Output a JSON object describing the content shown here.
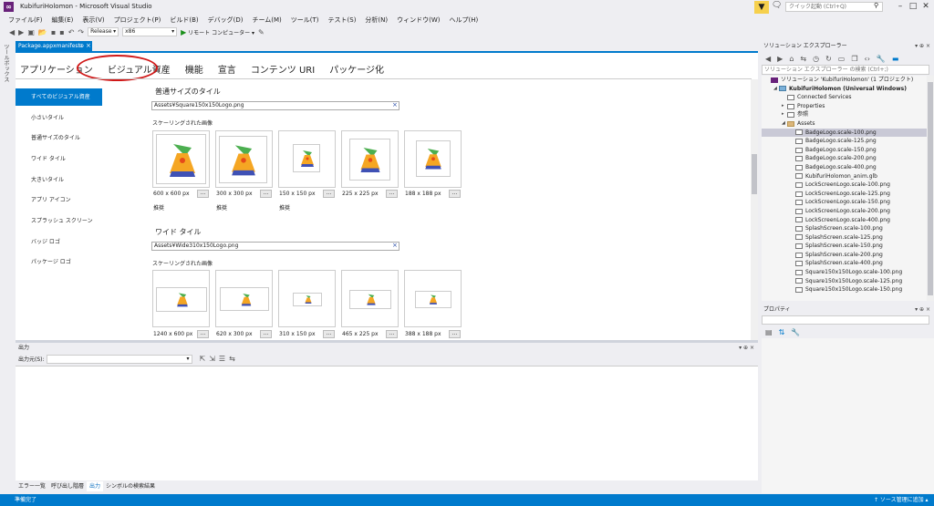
{
  "window": {
    "title": "KubifuriHolomon - Microsoft Visual Studio",
    "quick_launch_placeholder": "クイック起動 (Ctrl+Q)"
  },
  "menu": [
    "ファイル(F)",
    "編集(E)",
    "表示(V)",
    "プロジェクト(P)",
    "ビルド(B)",
    "デバッグ(D)",
    "チーム(M)",
    "ツール(T)",
    "テスト(S)",
    "分析(N)",
    "ウィンドウ(W)",
    "ヘルプ(H)"
  ],
  "toolbar": {
    "config": "Release",
    "platform": "x86",
    "run_label": "リモート コンピューター"
  },
  "left_strip": {
    "toolbox_label": "ツールボックス"
  },
  "document_tab": {
    "label": "Package.appxmanifest",
    "pin": "⊕",
    "close": "×"
  },
  "manifest_tabs": [
    "アプリケーション",
    "ビジュアル資産",
    "機能",
    "宣言",
    "コンテンツ URI",
    "パッケージ化"
  ],
  "left_nav": [
    "すべてのビジュアル資産",
    "小さいタイル",
    "普通サイズのタイル",
    "ワイド タイル",
    "大きいタイル",
    "アプリ アイコン",
    "スプラッシュ スクリーン",
    "バッジ ロゴ",
    "パッケージ ロゴ"
  ],
  "sections": {
    "medium": {
      "title": "普通サイズのタイル",
      "path": "Assets¥Square150x150Logo.png",
      "scaled_label": "スケーリングされた画像",
      "tiles": [
        {
          "size": "600 x 600 px",
          "recommended": "推奨"
        },
        {
          "size": "300 x 300 px",
          "recommended": "推奨"
        },
        {
          "size": "150 x 150 px",
          "recommended": "推奨"
        },
        {
          "size": "225 x 225 px",
          "recommended": ""
        },
        {
          "size": "188 x 188 px",
          "recommended": ""
        }
      ]
    },
    "wide": {
      "title": "ワイド タイル",
      "path": "Assets¥Wide310x150Logo.png",
      "scaled_label": "スケーリングされた画像",
      "tiles": [
        {
          "size": "1240 x 600 px"
        },
        {
          "size": "620 x 300 px"
        },
        {
          "size": "310 x 150 px"
        },
        {
          "size": "465 x 225 px"
        },
        {
          "size": "388 x 188 px"
        }
      ]
    },
    "browse_label": "...",
    "clear_label": "×"
  },
  "output": {
    "header": "出力",
    "source_label": "出力元(S):",
    "header_controls": "▾ ⊕ ×"
  },
  "bottom_tabs": [
    "エラー一覧",
    "呼び出し階層",
    "出力",
    "シンボルの検索結果"
  ],
  "status": {
    "left": "準備完了",
    "right": "↑ ソース管理に追加 ▴"
  },
  "solution_explorer": {
    "header": "ソリューション エクスプローラー",
    "header_controls": "▾ ⊕ ×",
    "search_placeholder": "ソリューション エクスプローラー の検索 (Ctrl+;)",
    "tree": [
      {
        "label": "ソリューション 'KubifuriHolomon' (1 プロジェクト)",
        "depth": 0,
        "arrow": "",
        "icon": "sol",
        "bold": false
      },
      {
        "label": "KubifuriHolomon (Universal Windows)",
        "depth": 1,
        "arrow": "◢",
        "icon": "proj",
        "bold": true
      },
      {
        "label": "Connected Services",
        "depth": 2,
        "arrow": "",
        "icon": "file"
      },
      {
        "label": "Properties",
        "depth": 2,
        "arrow": "▸",
        "icon": "file"
      },
      {
        "label": "参照",
        "depth": 2,
        "arrow": "▸",
        "icon": "file"
      },
      {
        "label": "Assets",
        "depth": 2,
        "arrow": "◢",
        "icon": "folder"
      },
      {
        "label": "BadgeLogo.scale-100.png",
        "depth": 3,
        "arrow": "",
        "icon": "file",
        "selected": true
      },
      {
        "label": "BadgeLogo.scale-125.png",
        "depth": 3,
        "arrow": "",
        "icon": "file"
      },
      {
        "label": "BadgeLogo.scale-150.png",
        "depth": 3,
        "arrow": "",
        "icon": "file"
      },
      {
        "label": "BadgeLogo.scale-200.png",
        "depth": 3,
        "arrow": "",
        "icon": "file"
      },
      {
        "label": "BadgeLogo.scale-400.png",
        "depth": 3,
        "arrow": "",
        "icon": "file"
      },
      {
        "label": "KubifuriHolomon_anim.glb",
        "depth": 3,
        "arrow": "",
        "icon": "file"
      },
      {
        "label": "LockScreenLogo.scale-100.png",
        "depth": 3,
        "arrow": "",
        "icon": "file"
      },
      {
        "label": "LockScreenLogo.scale-125.png",
        "depth": 3,
        "arrow": "",
        "icon": "file"
      },
      {
        "label": "LockScreenLogo.scale-150.png",
        "depth": 3,
        "arrow": "",
        "icon": "file"
      },
      {
        "label": "LockScreenLogo.scale-200.png",
        "depth": 3,
        "arrow": "",
        "icon": "file"
      },
      {
        "label": "LockScreenLogo.scale-400.png",
        "depth": 3,
        "arrow": "",
        "icon": "file"
      },
      {
        "label": "SplashScreen.scale-100.png",
        "depth": 3,
        "arrow": "",
        "icon": "file"
      },
      {
        "label": "SplashScreen.scale-125.png",
        "depth": 3,
        "arrow": "",
        "icon": "file"
      },
      {
        "label": "SplashScreen.scale-150.png",
        "depth": 3,
        "arrow": "",
        "icon": "file"
      },
      {
        "label": "SplashScreen.scale-200.png",
        "depth": 3,
        "arrow": "",
        "icon": "file"
      },
      {
        "label": "SplashScreen.scale-400.png",
        "depth": 3,
        "arrow": "",
        "icon": "file"
      },
      {
        "label": "Square150x150Logo.scale-100.png",
        "depth": 3,
        "arrow": "",
        "icon": "file"
      },
      {
        "label": "Square150x150Logo.scale-125.png",
        "depth": 3,
        "arrow": "",
        "icon": "file"
      },
      {
        "label": "Square150x150Logo.scale-150.png",
        "depth": 3,
        "arrow": "",
        "icon": "file"
      }
    ]
  },
  "properties": {
    "header": "プロパティ",
    "header_controls": "▾ ⊕ ×"
  },
  "colors": {
    "accent": "#007acc",
    "highlight": "#d01818",
    "selected": "#c9c9d6"
  }
}
